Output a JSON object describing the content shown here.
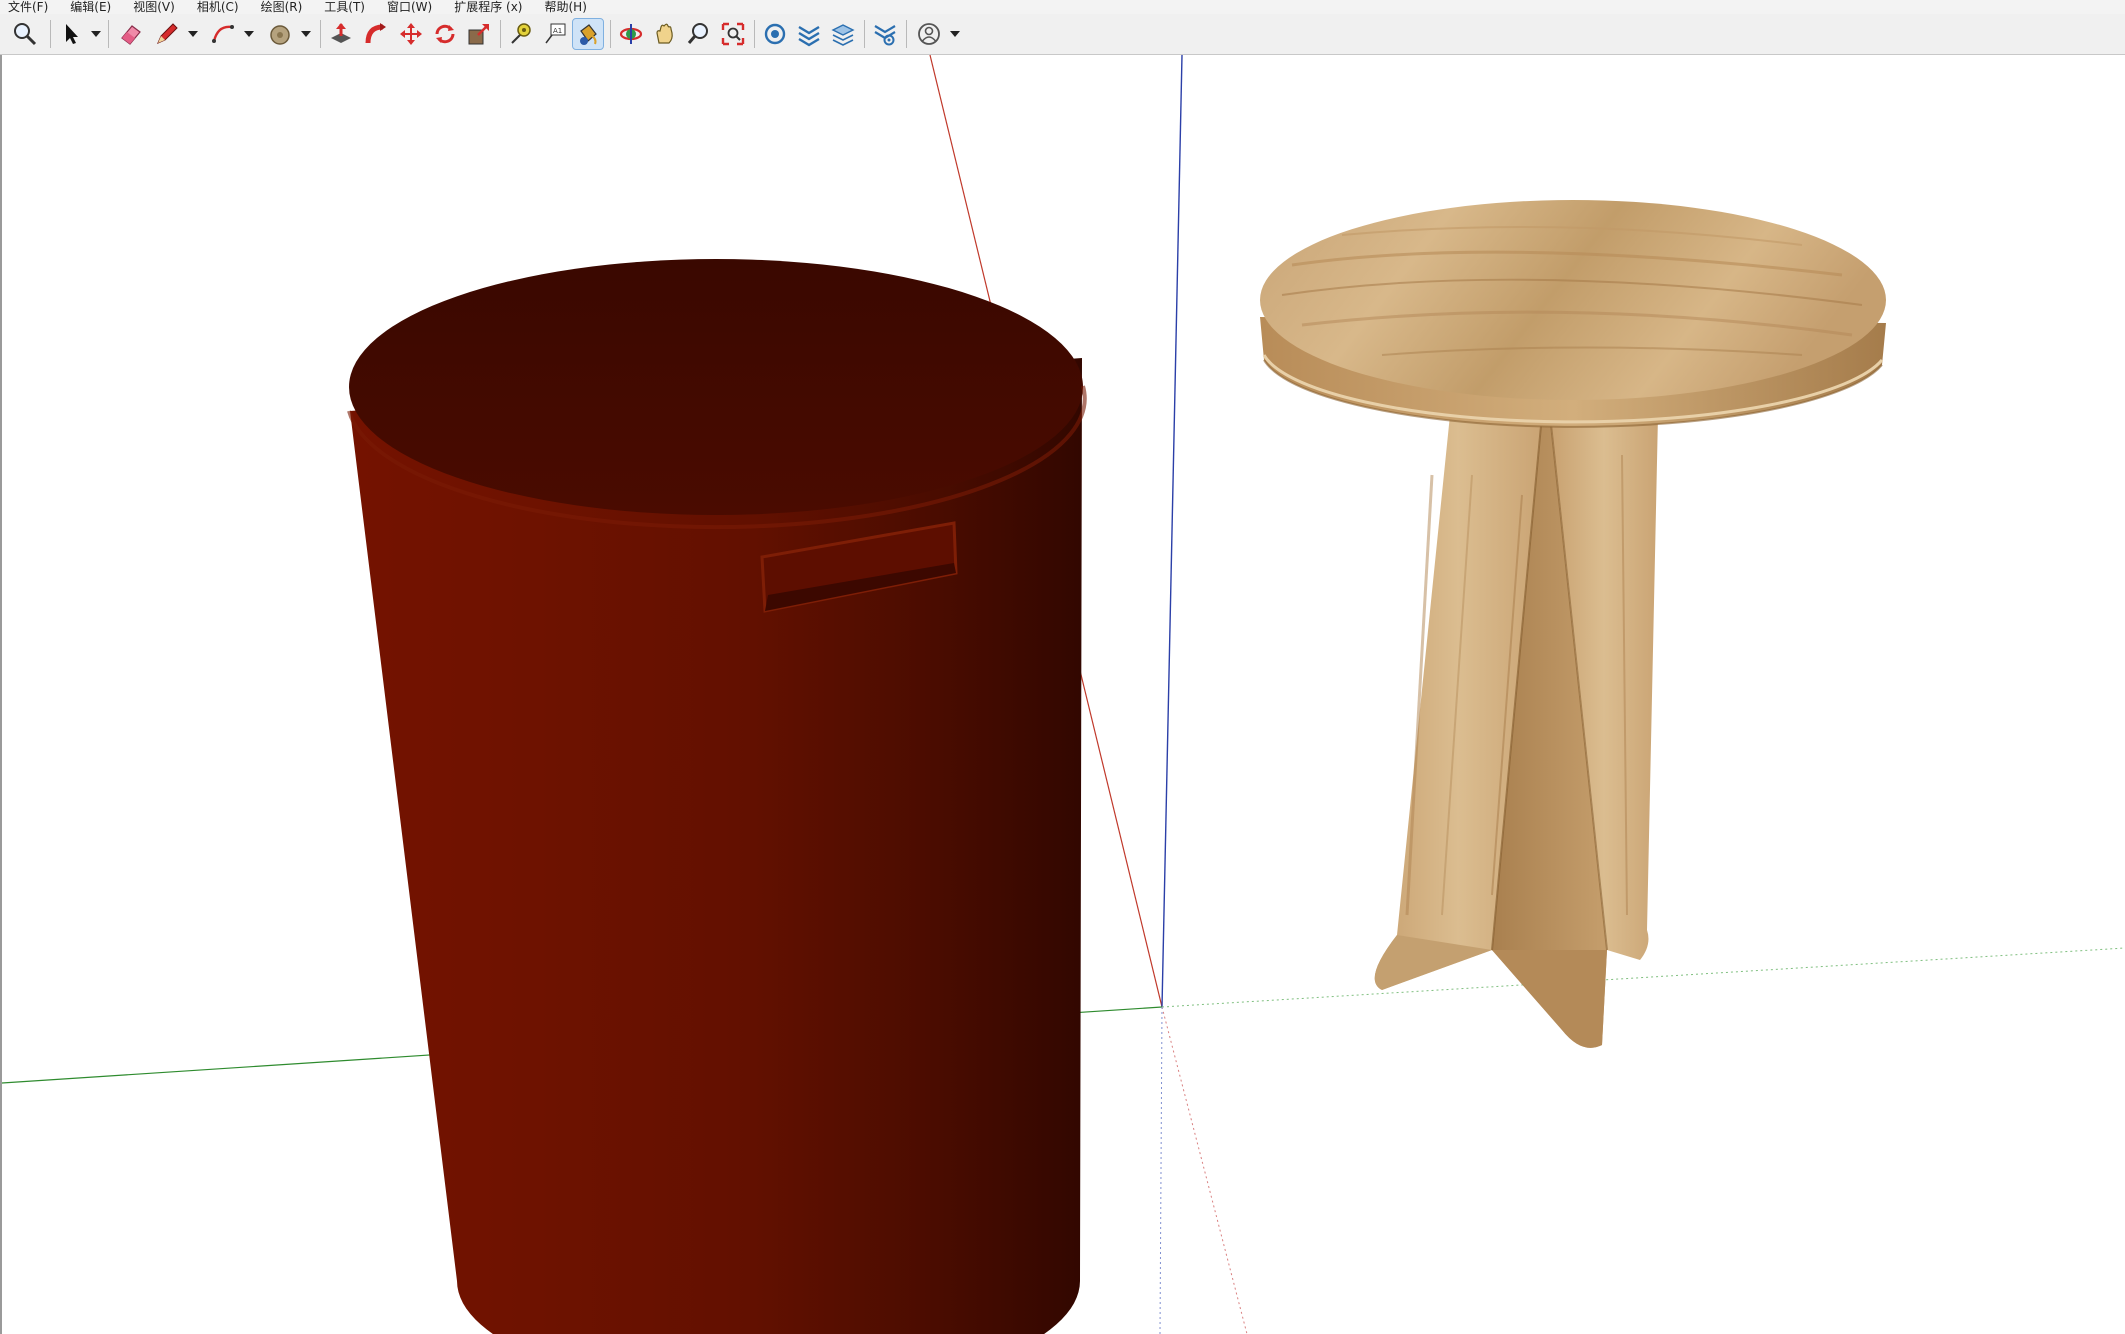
{
  "menu": {
    "items": [
      {
        "label": "文件(F)"
      },
      {
        "label": "编辑(E)"
      },
      {
        "label": "视图(V)"
      },
      {
        "label": "相机(C)"
      },
      {
        "label": "绘图(R)"
      },
      {
        "label": "工具(T)"
      },
      {
        "label": "窗口(W)"
      },
      {
        "label": "扩展程序 (x)"
      },
      {
        "label": "帮助(H)"
      }
    ]
  },
  "toolbar": {
    "tools": [
      {
        "icon": "zoom-icon"
      },
      {
        "icon": "select-arrow-icon"
      },
      {
        "icon": "eraser-icon"
      },
      {
        "icon": "pencil-line-icon"
      },
      {
        "icon": "arc-icon"
      },
      {
        "icon": "circle-shape-icon"
      },
      {
        "icon": "push-pull-icon"
      },
      {
        "icon": "follow-me-icon"
      },
      {
        "icon": "move-icon"
      },
      {
        "icon": "rotate-icon"
      },
      {
        "icon": "scale-icon"
      },
      {
        "icon": "tape-measure-icon"
      },
      {
        "icon": "text-label-icon"
      },
      {
        "icon": "paint-bucket-icon",
        "active": true
      },
      {
        "icon": "orbit-icon"
      },
      {
        "icon": "pan-hand-icon"
      },
      {
        "icon": "zoom-tool-icon"
      },
      {
        "icon": "zoom-extents-icon"
      },
      {
        "icon": "warehouse-icon"
      },
      {
        "icon": "extension-icon"
      },
      {
        "icon": "layers-icon"
      },
      {
        "icon": "extension-manager-icon"
      },
      {
        "icon": "account-icon"
      }
    ]
  },
  "scene": {
    "axes": {
      "red": "#c0392b",
      "green": "#2e8b2e",
      "blue": "#2b3fa8"
    },
    "objects": [
      "red-cylinder-stool",
      "wooden-pedestal-stool"
    ],
    "colors": {
      "cylinder": "#5a0e00",
      "wood": "#d5b286"
    }
  }
}
